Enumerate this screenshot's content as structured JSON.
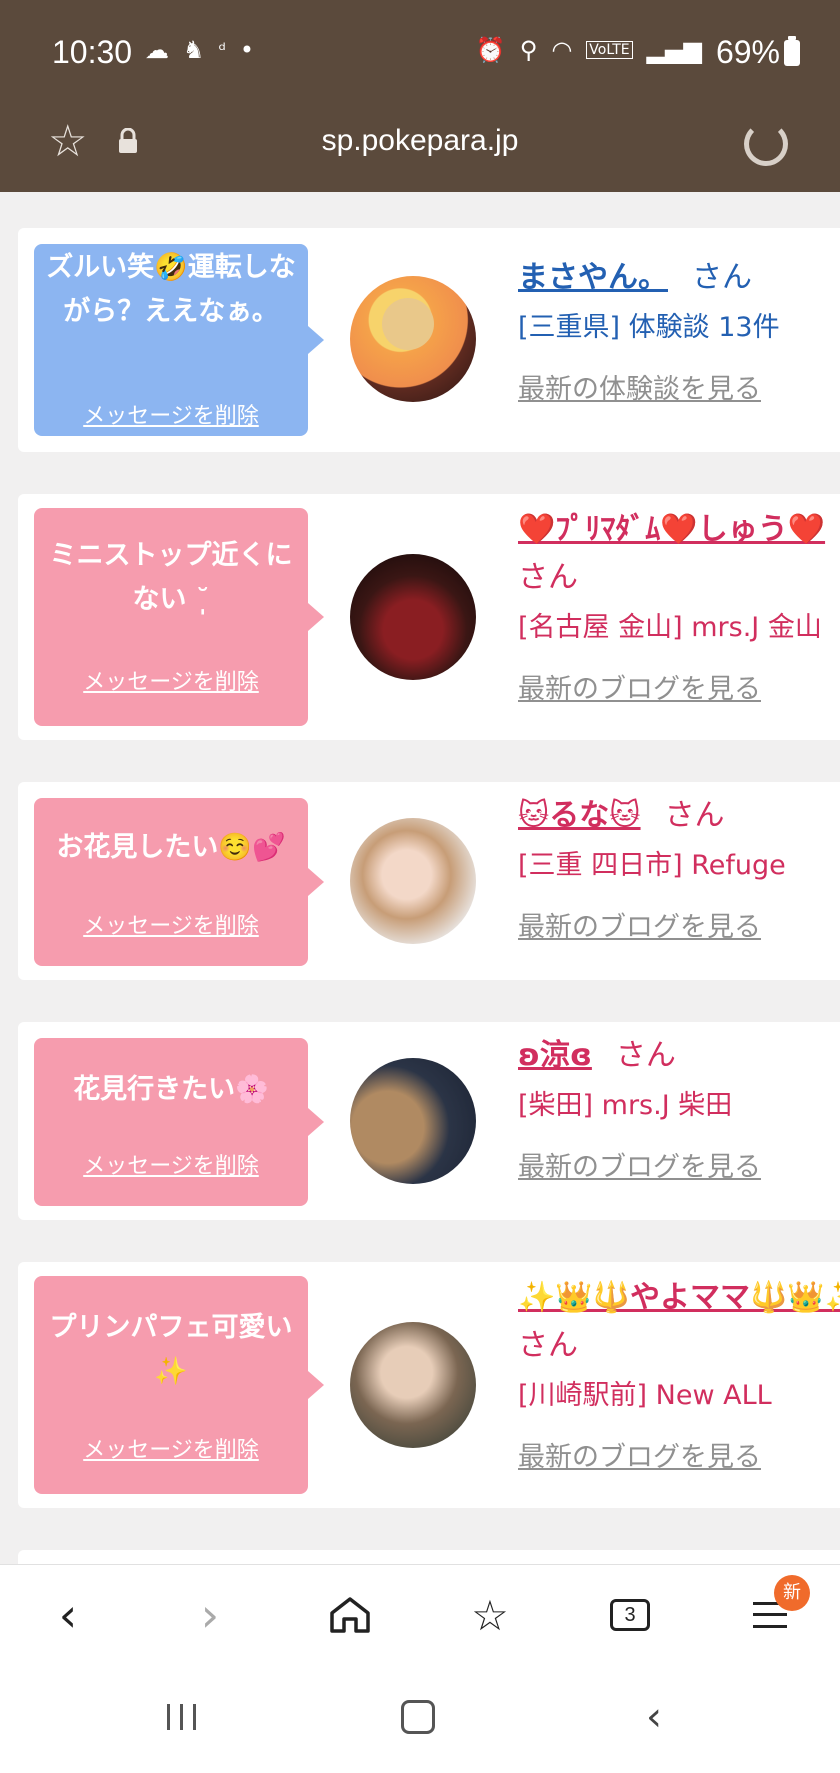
{
  "status_bar": {
    "time": "10:30",
    "battery": "69%",
    "icons": [
      "cloud-icon",
      "notification-icon",
      "d-icon",
      "dot-icon",
      "alarm-icon",
      "location-icon",
      "wifi-icon",
      "volte-icon",
      "signal-icon",
      "battery-icon"
    ]
  },
  "url_bar": {
    "url": "sp.pokepara.jp"
  },
  "messages": [
    {
      "bubble_text": "ズルい笑🤣運転しながら？ええなぁ。",
      "delete_label": "メッセージを削除",
      "name": "まさやん。",
      "san": "さん",
      "place": "[三重県] 体験談 13件",
      "more_link": "最新の体験談を見る"
    },
    {
      "bubble_text": "ミニストップ近くにない ˘̩̩̩",
      "delete_label": "メッセージを削除",
      "name": "❤️ﾌﾟﾘﾏﾀﾞﾑ❤️しゅう❤️",
      "san": "さん",
      "place": "[名古屋 金山] mrs.J 金山",
      "more_link": "最新のブログを見る"
    },
    {
      "bubble_text": "お花見したい☺️💕",
      "delete_label": "メッセージを削除",
      "name": "🐱るな🐱",
      "san": "さん",
      "place": "[三重 四日市] Refuge",
      "more_link": "最新のブログを見る"
    },
    {
      "bubble_text": "花見行きたい🌸",
      "delete_label": "メッセージを削除",
      "name": "ʚ涼ɞ",
      "san": "さん",
      "place": "[柴田] mrs.J 柴田",
      "more_link": "最新のブログを見る"
    },
    {
      "bubble_text": "プリンパフェ可愛い✨",
      "delete_label": "メッセージを削除",
      "name": "✨👑🔱やよママ🔱👑✨",
      "san": "さん",
      "place": "[川崎駅前] New ALL",
      "more_link": "最新のブログを見る"
    }
  ],
  "bottom_nav": {
    "tabs_count": "3",
    "new_badge": "新"
  },
  "colors": {
    "header": "#5b4a3c",
    "bubble_blue": "#8cb5f1",
    "bubble_pink": "#f69cae",
    "name_blue": "#2360b2",
    "name_pink": "#d12e5e"
  }
}
